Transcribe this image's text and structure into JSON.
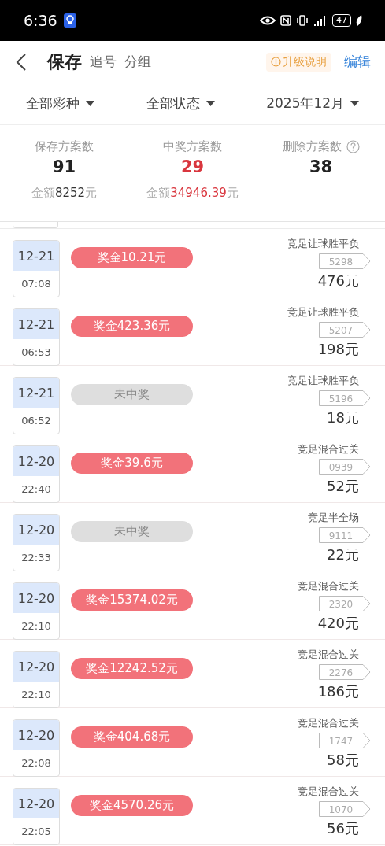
{
  "status_bar": {
    "time": "6:36",
    "battery": "47"
  },
  "header": {
    "title": "保存",
    "tabs": [
      {
        "label": "追号",
        "selected": false
      },
      {
        "label": "分组",
        "selected": false
      }
    ],
    "upgrade": "升级说明",
    "edit": "编辑"
  },
  "filters": [
    {
      "label": "全部彩种"
    },
    {
      "label": "全部状态"
    },
    {
      "label": "2025年12月"
    }
  ],
  "stats": [
    {
      "label": "保存方案数",
      "value": "91",
      "highlight": false,
      "help": false,
      "amount_label": "金额",
      "amount": "8252",
      "unit": "元"
    },
    {
      "label": "中奖方案数",
      "value": "29",
      "highlight": true,
      "help": false,
      "amount_label": "金额",
      "amount": "34946.39",
      "unit": "元"
    },
    {
      "label": "删除方案数",
      "value": "38",
      "highlight": false,
      "help": true
    }
  ],
  "records": [
    {
      "date": "12-21",
      "time": "07:08",
      "won": true,
      "prize": "奖金10.21元",
      "game": "竞足让球胜平负",
      "code": "5298",
      "stake": "476元"
    },
    {
      "date": "12-21",
      "time": "06:53",
      "won": true,
      "prize": "奖金423.36元",
      "game": "竞足让球胜平负",
      "code": "5207",
      "stake": "198元"
    },
    {
      "date": "12-21",
      "time": "06:52",
      "won": false,
      "prize": "未中奖",
      "game": "竞足让球胜平负",
      "code": "5196",
      "stake": "18元"
    },
    {
      "date": "12-20",
      "time": "22:40",
      "won": true,
      "prize": "奖金39.6元",
      "game": "竞足混合过关",
      "code": "0939",
      "stake": "52元"
    },
    {
      "date": "12-20",
      "time": "22:33",
      "won": false,
      "prize": "未中奖",
      "game": "竞足半全场",
      "code": "9111",
      "stake": "22元"
    },
    {
      "date": "12-20",
      "time": "22:10",
      "won": true,
      "prize": "奖金15374.02元",
      "game": "竞足混合过关",
      "code": "2320",
      "stake": "420元"
    },
    {
      "date": "12-20",
      "time": "22:10",
      "won": true,
      "prize": "奖金12242.52元",
      "game": "竞足混合过关",
      "code": "2276",
      "stake": "186元"
    },
    {
      "date": "12-20",
      "time": "22:08",
      "won": true,
      "prize": "奖金404.68元",
      "game": "竞足混合过关",
      "code": "1747",
      "stake": "58元"
    },
    {
      "date": "12-20",
      "time": "22:05",
      "won": true,
      "prize": "奖金4570.26元",
      "game": "竞足混合过关",
      "code": "1070",
      "stake": "56元"
    }
  ]
}
